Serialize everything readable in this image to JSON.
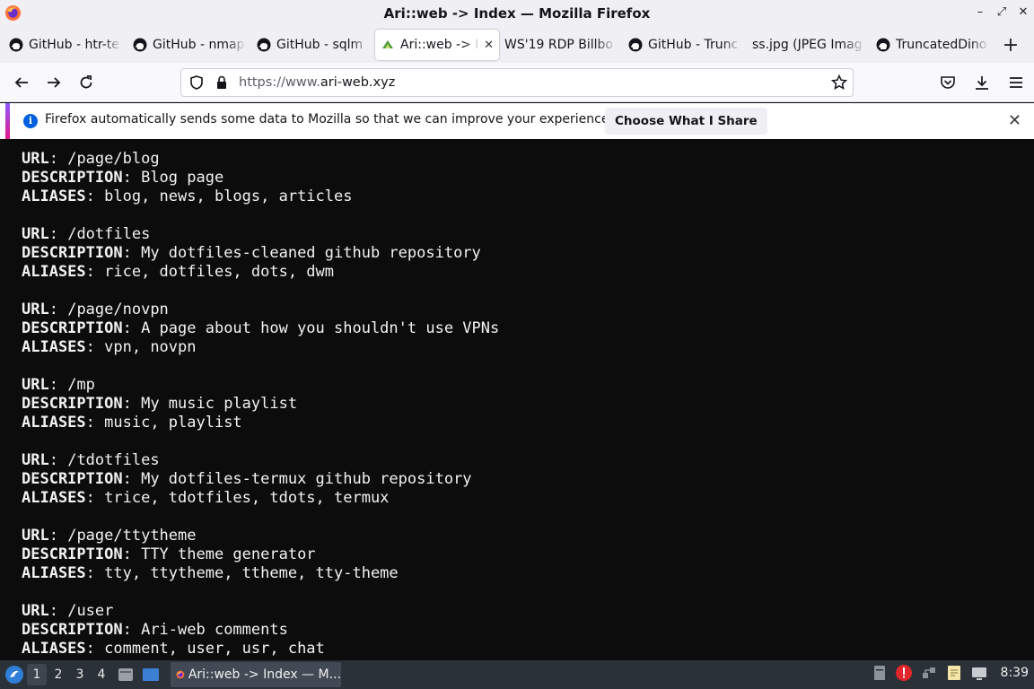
{
  "window": {
    "title": "Ari::web -> Index — Mozilla Firefox",
    "controls": [
      "–",
      "⤢",
      "✕"
    ]
  },
  "tabs": [
    {
      "label": "GitHub - htr-te",
      "icon": "github-icon",
      "active": false
    },
    {
      "label": "GitHub - nmap",
      "icon": "github-icon",
      "active": false
    },
    {
      "label": "GitHub - sqlm",
      "icon": "github-icon",
      "active": false
    },
    {
      "label": "Ari::web -> I",
      "icon": "site-favicon-icon",
      "active": true
    },
    {
      "label": "WS'19 RDP Billbo",
      "icon": "none",
      "active": false
    },
    {
      "label": "GitHub - Trunc",
      "icon": "github-icon",
      "active": false
    },
    {
      "label": "ss.jpg (JPEG Imag",
      "icon": "none",
      "active": false
    },
    {
      "label": "TruncatedDino",
      "icon": "github-icon",
      "active": false
    }
  ],
  "newtab": "+",
  "navbar": {
    "url_prefix": "https://www.",
    "url_host": "ari-web.xyz"
  },
  "notification": {
    "message": "Firefox automatically sends some data to Mozilla so that we can improve your experience.",
    "button": "Choose What I Share"
  },
  "entries": [
    {
      "url": "/page/blog",
      "description": "Blog page",
      "aliases": "blog, news, blogs, articles"
    },
    {
      "url": "/dotfiles",
      "description": "My dotfiles-cleaned github repository",
      "aliases": "rice, dotfiles, dots, dwm"
    },
    {
      "url": "/page/novpn",
      "description": "A page about how you shouldn't use VPNs",
      "aliases": "vpn, novpn"
    },
    {
      "url": "/mp",
      "description": "My music playlist",
      "aliases": "music, playlist"
    },
    {
      "url": "/tdotfiles",
      "description": "My dotfiles-termux github repository",
      "aliases": "trice, tdotfiles, tdots, termux"
    },
    {
      "url": "/page/ttytheme",
      "description": "TTY theme generator",
      "aliases": "tty, ttytheme, ttheme, tty-theme"
    },
    {
      "url": "/user",
      "description": "Ari-web comments",
      "aliases": "comment, user, usr, chat"
    }
  ],
  "labels": {
    "url": "URL",
    "description": "DESCRIPTION",
    "aliases": "ALIASES"
  },
  "taskbar": {
    "workspaces": [
      "1",
      "2",
      "3",
      "4"
    ],
    "active_window": "Ari::web -> Index — M...",
    "clock": "8:39"
  }
}
